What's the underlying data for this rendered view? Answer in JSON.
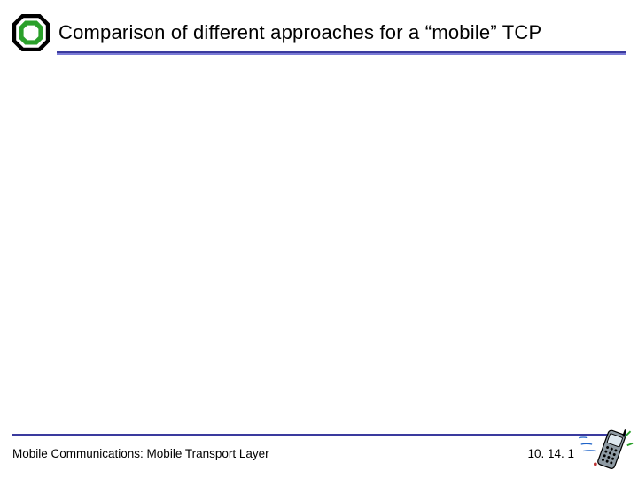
{
  "title": "Comparison of different approaches for a “mobile” TCP",
  "footer": {
    "left": "Mobile Communications: Mobile Transport Layer",
    "right": "10. 14. 1"
  },
  "colors": {
    "rule_dark": "#3a3a9e",
    "rule_light": "#7a7ad6",
    "logo_outer": "#000000",
    "logo_inner": "#2aa02a"
  }
}
